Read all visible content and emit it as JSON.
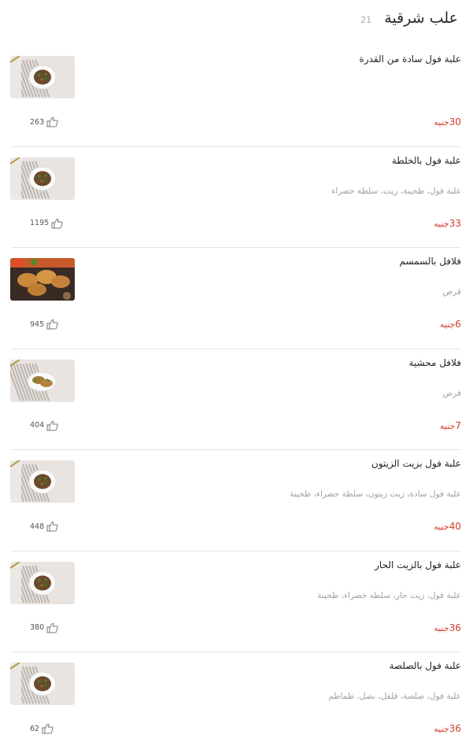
{
  "header": {
    "title": "علب شرقية",
    "count": "21"
  },
  "items": [
    {
      "name": "علبة فول سادة من القدرة",
      "description": "",
      "price": "30",
      "currency": "جنيه",
      "likes": "263",
      "image": "ful-box-photo"
    },
    {
      "name": "علبة فول بالخلطة",
      "description": "علبة فول، طحينة، زيت، سلطة خضراء",
      "price": "33",
      "currency": "جنيه",
      "likes": "1195",
      "image": "ful-box-photo"
    },
    {
      "name": "فلافل بالسمسم",
      "description": "قرص",
      "price": "6",
      "currency": "جنيه",
      "likes": "945",
      "image": "falafel-photo"
    },
    {
      "name": "فلافل محشية",
      "description": "قرص",
      "price": "7",
      "currency": "جنيه",
      "likes": "404",
      "image": "stuffed-falafel-photo"
    },
    {
      "name": "علبة فول بزيت الزيتون",
      "description": "علبة فول سادة، زيت زيتون، سلطة خضراء، طحينة",
      "price": "40",
      "currency": "جنيه",
      "likes": "448",
      "image": "ful-box-photo"
    },
    {
      "name": "علبة فول بالزيت الحار",
      "description": "علبة فول، زيت حار، سلطه خضراء، طحينة",
      "price": "36",
      "currency": "جنيه",
      "likes": "380",
      "image": "ful-box-photo"
    },
    {
      "name": "علبة فول بالصلصة",
      "description": "علبة فول، صلصة، فلفل، بصل، طماطم",
      "price": "36",
      "currency": "جنيه",
      "likes": "62",
      "image": "ful-box-photo"
    }
  ],
  "colors": {
    "price": "#d23a2a",
    "muted": "#a0a0a0",
    "divider": "#e6e6e6"
  }
}
